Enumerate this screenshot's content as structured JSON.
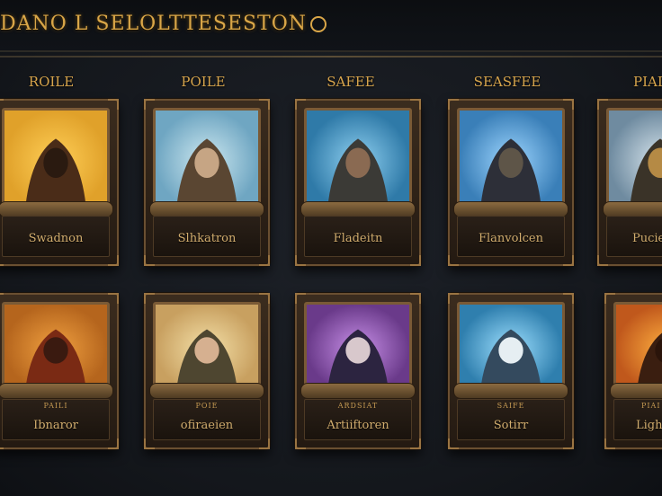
{
  "title": "DANO L SELOLTTESESTON",
  "columns": [
    "ROILE",
    "POILE",
    "SAFEE",
    "SEASFEE",
    "PIAI"
  ],
  "cards": [
    {
      "row": "top",
      "name": "Swadnon",
      "sub": "",
      "theme": {
        "bg": "#e0a12a",
        "glow": "#ffcf57",
        "hood": "#4a2c18",
        "face": "#2a1a10"
      }
    },
    {
      "row": "top",
      "name": "Slhkatron",
      "sub": "",
      "theme": {
        "bg": "#6fa6c2",
        "glow": "#cde8f0",
        "hood": "#5a4632",
        "face": "#c6a584"
      }
    },
    {
      "row": "top",
      "name": "Fladeitn",
      "sub": "",
      "theme": {
        "bg": "#2f7aa8",
        "glow": "#8fd0f0",
        "hood": "#3b3a36",
        "face": "#8a6a52"
      }
    },
    {
      "row": "top",
      "name": "Flanvolcen",
      "sub": "",
      "theme": {
        "bg": "#3a7fb8",
        "glow": "#9ed6ff",
        "hood": "#2d2f38",
        "face": "#5e5548"
      }
    },
    {
      "row": "top",
      "name": "Pucie",
      "sub": "",
      "theme": {
        "bg": "#6f8ba0",
        "glow": "#d6e4ec",
        "hood": "#3a3328",
        "face": "#b58a45"
      }
    },
    {
      "row": "bottom",
      "name": "Ibnaror",
      "sub": "PAILI",
      "theme": {
        "bg": "#b5651d",
        "glow": "#f0a040",
        "hood": "#7a2a14",
        "face": "#3a1a10"
      }
    },
    {
      "row": "bottom",
      "name": "ofiraeien",
      "sub": "POIE",
      "theme": {
        "bg": "#c8a060",
        "glow": "#f4e0a8",
        "hood": "#4e4630",
        "face": "#d6b090"
      }
    },
    {
      "row": "bottom",
      "name": "Artiiftoren",
      "sub": "ARDSIAT",
      "theme": {
        "bg": "#6a3a8a",
        "glow": "#c890e8",
        "hood": "#2c2440",
        "face": "#d8c8cc"
      }
    },
    {
      "row": "bottom",
      "name": "Sotirr",
      "sub": "SAIFE",
      "theme": {
        "bg": "#2f7fae",
        "glow": "#9ee0ff",
        "hood": "#344a5e",
        "face": "#e6eef2"
      }
    },
    {
      "row": "bottom",
      "name": "Lightl",
      "sub": "PIAI",
      "theme": {
        "bg": "#c0581c",
        "glow": "#ffb040",
        "hood": "#3a1e10",
        "face": "#2a140a"
      }
    }
  ]
}
